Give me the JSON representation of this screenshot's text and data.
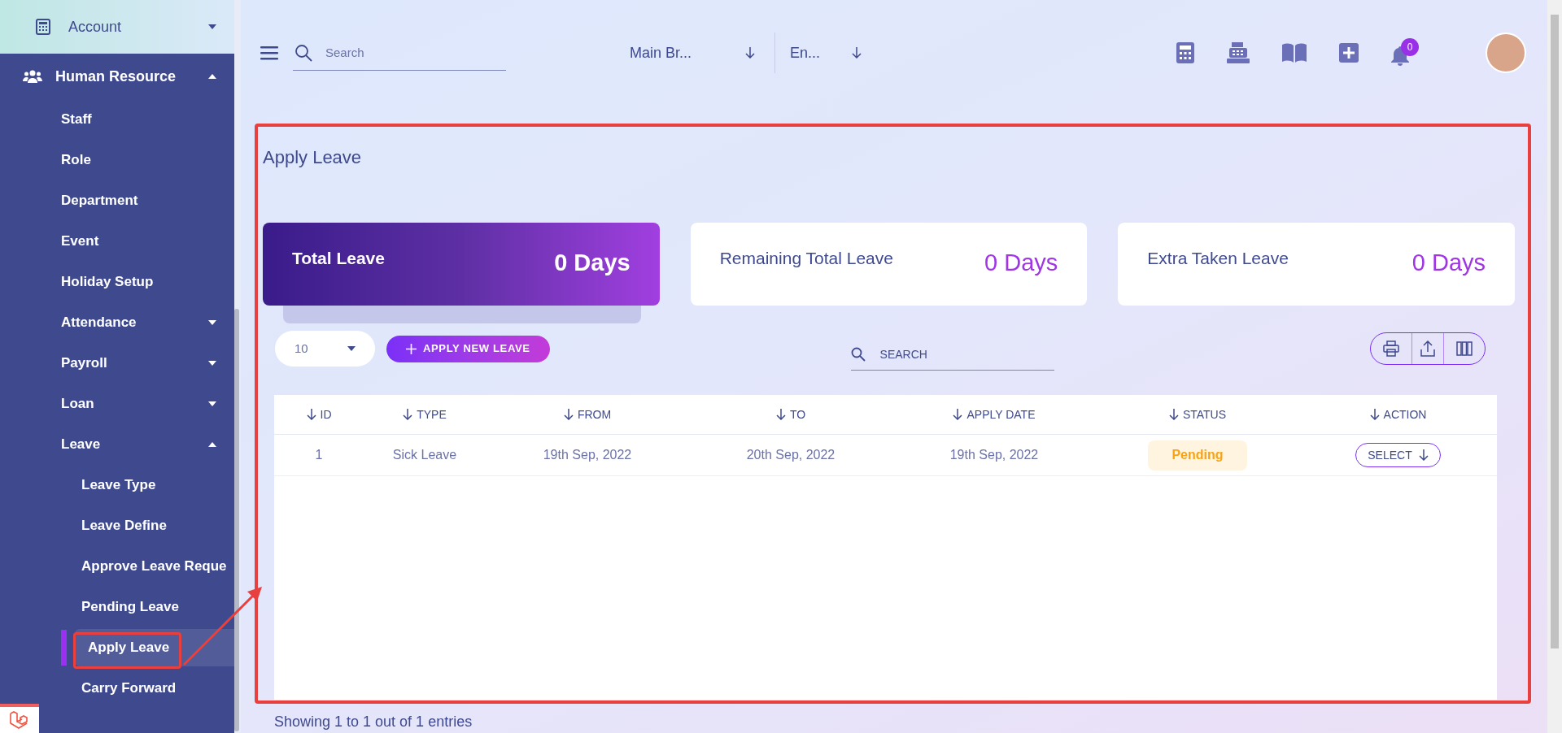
{
  "sidebar": {
    "items": [
      {
        "label": "Account",
        "expanded": false
      },
      {
        "label": "Human Resource",
        "expanded": true,
        "children": [
          {
            "label": "Staff",
            "selected": false
          },
          {
            "label": "Role",
            "selected": false
          },
          {
            "label": "Department",
            "selected": false
          },
          {
            "label": "Event",
            "selected": false
          },
          {
            "label": "Holiday Setup",
            "selected": false
          },
          {
            "label": "Attendance",
            "expanded": false,
            "selected": false
          },
          {
            "label": "Payroll",
            "expanded": false,
            "selected": false
          },
          {
            "label": "Loan",
            "expanded": false,
            "selected": false
          },
          {
            "label": "Leave",
            "expanded": true,
            "selected": false,
            "children": [
              {
                "label": "Leave Type",
                "selected": false
              },
              {
                "label": "Leave Define",
                "selected": false
              },
              {
                "label": "Approve Leave Reque",
                "selected": false
              },
              {
                "label": "Pending Leave",
                "selected": false
              },
              {
                "label": "Apply Leave",
                "selected": true
              },
              {
                "label": "Carry Forward",
                "selected": false
              }
            ]
          }
        ]
      }
    ]
  },
  "topbar": {
    "search": {
      "placeholder": "Search"
    },
    "branch": "Main Br...",
    "language": "En...",
    "notifications": "0"
  },
  "page_title": "Apply Leave",
  "cards": [
    {
      "kind": "highlight",
      "label": "Total Leave",
      "value": "0 Days"
    },
    {
      "kind": "plain",
      "label": "Remaining Total Leave",
      "value": "0 Days"
    },
    {
      "kind": "plain",
      "label": "Extra Taken Leave",
      "value": "0 Days"
    }
  ],
  "toolbar": {
    "page_length": "10",
    "apply_button": "APPLY NEW LEAVE",
    "search": {
      "placeholder": "SEARCH"
    }
  },
  "table": {
    "columns": [
      "ID",
      "TYPE",
      "FROM",
      "TO",
      "APPLY DATE",
      "STATUS",
      "ACTION"
    ],
    "rows": [
      {
        "id": "1",
        "type": "Sick Leave",
        "from": "19th Sep, 2022",
        "to": "20th Sep, 2022",
        "apply_date": "19th Sep, 2022",
        "status": "Pending",
        "action": "SELECT"
      }
    ]
  },
  "footer": "Showing 1 to 1 out of 1 entries"
}
